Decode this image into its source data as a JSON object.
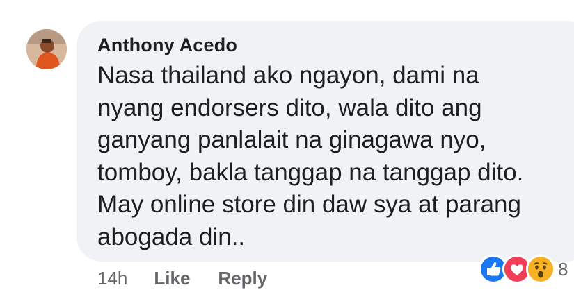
{
  "comment": {
    "author": "Anthony Acedo",
    "lines": [
      "Nasa thailand ako ngayon, dami na",
      "nyang endorsers dito, wala dito ang",
      "ganyang panlalait na ginagawa nyo,",
      "tomboy, bakla tanggap na tanggap dito.",
      "May online store din daw sya at parang",
      "abogada din.."
    ],
    "avatar_icon": "profile-photo"
  },
  "actions": {
    "timestamp": "14h",
    "like_label": "Like",
    "reply_label": "Reply"
  },
  "reactions": {
    "icons": [
      "like-reaction-icon",
      "love-reaction-icon",
      "wow-reaction-icon"
    ],
    "count": "8"
  },
  "colors": {
    "bubble": "#f0f2f5",
    "text": "#1c1e21",
    "meta": "#65676b",
    "like": "#1877f2",
    "love": "#f33e58",
    "wow": "#f7b125"
  }
}
